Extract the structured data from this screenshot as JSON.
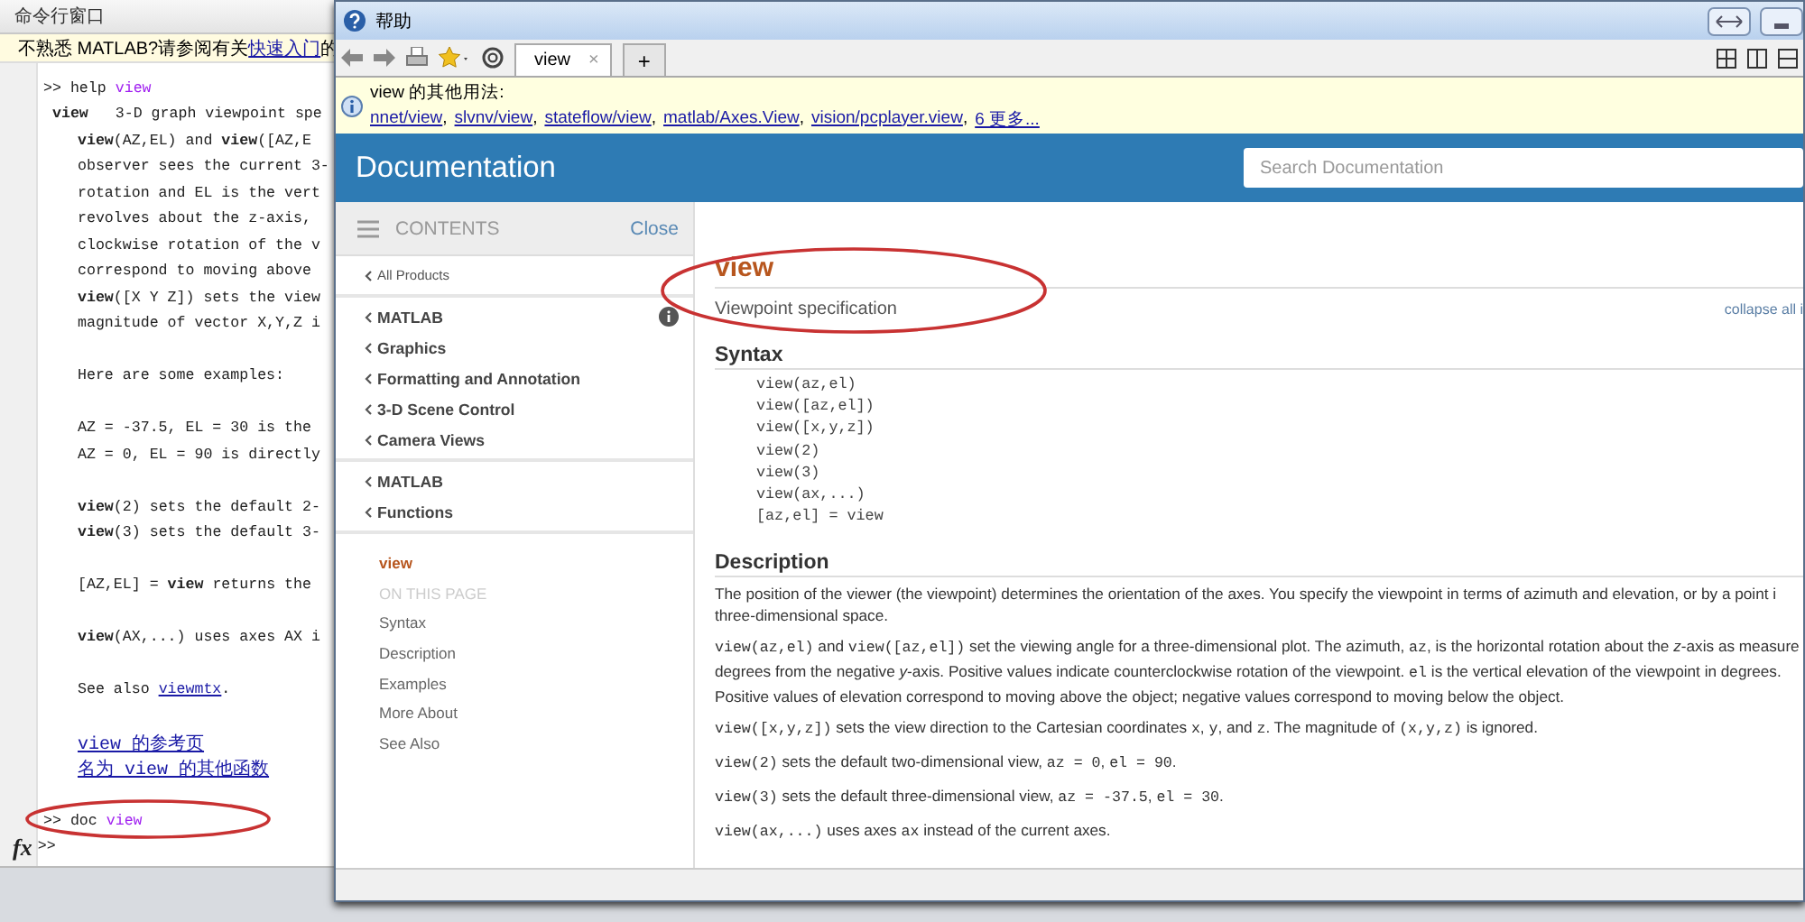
{
  "command_window": {
    "title": "命令行窗口",
    "banner": {
      "before": "不熟悉 MATLAB?请参阅有关",
      "link": "快速入门",
      "after": "的"
    },
    "lines": [
      {
        "kind": "prompt",
        "prompt": ">>",
        "command": "help",
        "arg": "view"
      },
      {
        "kind": "heading",
        "text": "**view**   3-D graph viewpoint spe"
      },
      {
        "kind": "body",
        "text": "**view**(AZ,EL) and **view**([AZ,E"
      },
      {
        "kind": "body",
        "text": "observer sees the current 3-"
      },
      {
        "kind": "body",
        "text": "rotation and EL is the vert"
      },
      {
        "kind": "body",
        "text": "revolves about the z-axis,"
      },
      {
        "kind": "body",
        "text": "clockwise rotation of the v"
      },
      {
        "kind": "body",
        "text": "correspond to moving above"
      },
      {
        "kind": "body",
        "text": "**view**([X Y Z]) sets the view"
      },
      {
        "kind": "body",
        "text": "magnitude of vector X,Y,Z i"
      },
      {
        "kind": "gap"
      },
      {
        "kind": "body",
        "text": "Here are some examples:"
      },
      {
        "kind": "gap"
      },
      {
        "kind": "body",
        "text": "AZ = -37.5, EL = 30 is the"
      },
      {
        "kind": "body",
        "text": "AZ = 0, EL = 90 is directly"
      },
      {
        "kind": "gap"
      },
      {
        "kind": "body",
        "text": "**view**(2) sets the default 2-"
      },
      {
        "kind": "body",
        "text": "**view**(3) sets the default 3-"
      },
      {
        "kind": "gap"
      },
      {
        "kind": "body",
        "text": "[AZ,EL] = **view** returns the"
      },
      {
        "kind": "gap"
      },
      {
        "kind": "body",
        "text": "**view**(AX,...) uses axes AX i"
      },
      {
        "kind": "gap"
      },
      {
        "kind": "see_also",
        "text": "See also ",
        "link": "viewmtx",
        "after": "."
      },
      {
        "kind": "gap"
      },
      {
        "kind": "link",
        "text": "view 的参考页"
      },
      {
        "kind": "link",
        "text": "名为 view 的其他函数"
      },
      {
        "kind": "gap"
      },
      {
        "kind": "prompt",
        "prompt": ">>",
        "command": "doc",
        "arg": "view"
      },
      {
        "kind": "fx",
        "fx": "fx",
        "prompt": ">>"
      }
    ]
  },
  "help_window": {
    "title": "帮助",
    "tabs": [
      {
        "label": "view",
        "selected": true,
        "close": "×"
      }
    ],
    "new_tab": "+",
    "info": {
      "label": "view 的其他用法:",
      "links": [
        {
          "text": "nnet/view",
          "sep": ","
        },
        {
          "text": "slvnv/view",
          "sep": ","
        },
        {
          "text": "stateflow/view",
          "sep": ","
        },
        {
          "text": "matlab/Axes.View",
          "sep": ","
        },
        {
          "text": "vision/pcplayer.view",
          "sep": ","
        },
        {
          "text": "6 更多..."
        }
      ]
    },
    "header": {
      "title": "Documentation",
      "search": {
        "placeholder": "Search Documentation"
      }
    },
    "sidebar": {
      "title": "CONTENTS",
      "close": "Close",
      "all_products": "All Products",
      "groups": [
        [
          "MATLAB",
          "Graphics",
          "Formatting and Annotation",
          "3-D Scene Control",
          "Camera Views"
        ],
        [
          "MATLAB",
          "Functions"
        ]
      ],
      "current": "view",
      "on_this_page": "ON THIS PAGE",
      "items": [
        {
          "label": "Syntax",
          "selected": false
        },
        {
          "label": "Description",
          "selected": false
        },
        {
          "label": "Examples",
          "selected": false
        },
        {
          "label": "More About",
          "selected": false
        },
        {
          "label": "See Also",
          "selected": false
        }
      ]
    },
    "page": {
      "title": "view",
      "subtitle": "Viewpoint specification",
      "collapse": "collapse all i",
      "syntax_heading": "Syntax",
      "syntax": [
        "view(az,el)",
        "view([az,el])",
        "view([x,y,z])",
        "view(2)",
        "view(3)",
        "view(ax,...)",
        "[az,el] = view"
      ],
      "description_heading": "Description",
      "paragraphs": [
        [
          [
            {
              "kind": "text",
              "text": "The position of the viewer (the viewpoint) determines the orientation of the axes. You specify the viewpoint in terms of azimuth and elevation, or by a point i"
            }
          ],
          [
            {
              "kind": "text",
              "text": "three-dimensional space."
            }
          ]
        ],
        [
          [
            {
              "kind": "code",
              "text": "view(az,el)"
            },
            {
              "kind": "text",
              "text": " and "
            },
            {
              "kind": "code",
              "text": "view([az,el])"
            },
            {
              "kind": "text",
              "text": " set the viewing angle for a three-dimensional plot. The azimuth, "
            },
            {
              "kind": "code",
              "text": "az"
            },
            {
              "kind": "text",
              "text": ", is the horizontal rotation about the "
            },
            {
              "kind": "italic",
              "text": "z"
            },
            {
              "kind": "text",
              "text": "-axis as measure"
            }
          ],
          [
            {
              "kind": "text",
              "text": "degrees from the negative "
            },
            {
              "kind": "italic",
              "text": "y"
            },
            {
              "kind": "text",
              "text": "-axis. Positive values indicate counterclockwise rotation of the viewpoint. "
            },
            {
              "kind": "code",
              "text": "el"
            },
            {
              "kind": "text",
              "text": " is the vertical elevation of the viewpoint in degrees."
            }
          ],
          [
            {
              "kind": "text",
              "text": "Positive values of elevation correspond to moving above the object; negative values correspond to moving below the object."
            }
          ]
        ],
        [
          [
            {
              "kind": "code",
              "text": "view([x,y,z])"
            },
            {
              "kind": "text",
              "text": " sets the view direction to the Cartesian coordinates "
            },
            {
              "kind": "code",
              "text": "x"
            },
            {
              "kind": "text",
              "text": ", "
            },
            {
              "kind": "code",
              "text": "y"
            },
            {
              "kind": "text",
              "text": ", and "
            },
            {
              "kind": "code",
              "text": "z"
            },
            {
              "kind": "text",
              "text": ". The magnitude of "
            },
            {
              "kind": "code",
              "text": "(x,y,z)"
            },
            {
              "kind": "text",
              "text": " is ignored."
            }
          ]
        ],
        [
          [
            {
              "kind": "code",
              "text": "view(2)"
            },
            {
              "kind": "text",
              "text": " sets the default two-dimensional view, "
            },
            {
              "kind": "code",
              "text": "az = 0"
            },
            {
              "kind": "text",
              "text": ", "
            },
            {
              "kind": "code",
              "text": "el = 90"
            },
            {
              "kind": "text",
              "text": "."
            }
          ]
        ],
        [
          [
            {
              "kind": "code",
              "text": "view(3)"
            },
            {
              "kind": "text",
              "text": " sets the default three-dimensional view, "
            },
            {
              "kind": "code",
              "text": "az = -37.5"
            },
            {
              "kind": "text",
              "text": ", "
            },
            {
              "kind": "code",
              "text": "el = 30"
            },
            {
              "kind": "text",
              "text": "."
            }
          ]
        ],
        [
          [
            {
              "kind": "code",
              "text": "view(ax,...)"
            },
            {
              "kind": "text",
              "text": " uses axes "
            },
            {
              "kind": "code",
              "text": "ax"
            },
            {
              "kind": "text",
              "text": " instead of the current axes."
            }
          ]
        ]
      ]
    }
  }
}
